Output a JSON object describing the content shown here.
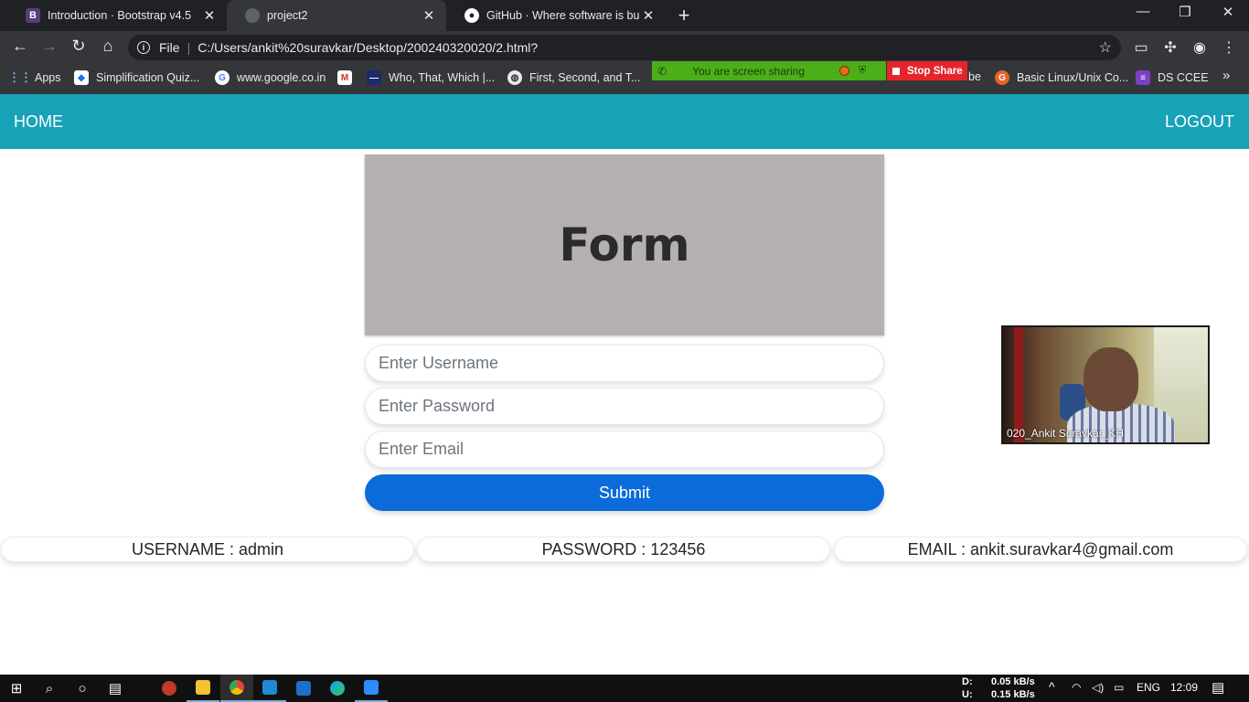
{
  "browser": {
    "tabs": [
      {
        "title": "Introduction · Bootstrap v4.5",
        "icon": "bootstrap-icon",
        "active": false
      },
      {
        "title": "project2",
        "icon": "globe-icon",
        "active": true
      },
      {
        "title": "GitHub · Where software is built",
        "icon": "github-icon",
        "active": false
      }
    ],
    "address": {
      "scheme": "File",
      "url": "C:/Users/ankit%20suravkar/Desktop/200240320020/2.html?"
    },
    "bookmarks": [
      {
        "label": "Apps",
        "icon": "apps-grid-icon"
      },
      {
        "label": "Simplification Quiz...",
        "icon": "bookmark-site-icon"
      },
      {
        "label": "www.google.co.in",
        "icon": "google-icon"
      },
      {
        "label": "",
        "icon": "gmail-icon"
      },
      {
        "label": "Who, That, Which |...",
        "icon": "bookmark-site-icon"
      },
      {
        "label": "First, Second, and T...",
        "icon": "globe-icon"
      },
      {
        "label": "be",
        "icon": ""
      },
      {
        "label": "Basic Linux/Unix Co...",
        "icon": "bookmark-site-icon"
      },
      {
        "label": "DS CCEE",
        "icon": "list-icon"
      }
    ],
    "more_bookmarks": "»"
  },
  "screen_share": {
    "status_text": "You are screen sharing",
    "stop_label": "Stop Share"
  },
  "site_nav": {
    "home": "HOME",
    "logout": "LOGOUT"
  },
  "form": {
    "title": "Form",
    "username_placeholder": "Enter Username",
    "password_placeholder": "Enter Password",
    "email_placeholder": "Enter Email",
    "submit_label": "Submit"
  },
  "results": {
    "username": "USERNAME : admin",
    "password": "PASSWORD : 123456",
    "email": "EMAIL : ankit.suravkar4@gmail.com"
  },
  "video": {
    "participant_name": "020_Ankit Suravkar_KH"
  },
  "taskbar": {
    "download_label": "D:",
    "download_speed": "0.05 kB/s",
    "upload_label": "U:",
    "upload_speed": "0.15 kB/s",
    "language": "ENG",
    "time": "12:09"
  },
  "colors": {
    "navbar": "#17a2b8",
    "submit": "#0b6bd8",
    "form_header": "#b5b1b1"
  }
}
